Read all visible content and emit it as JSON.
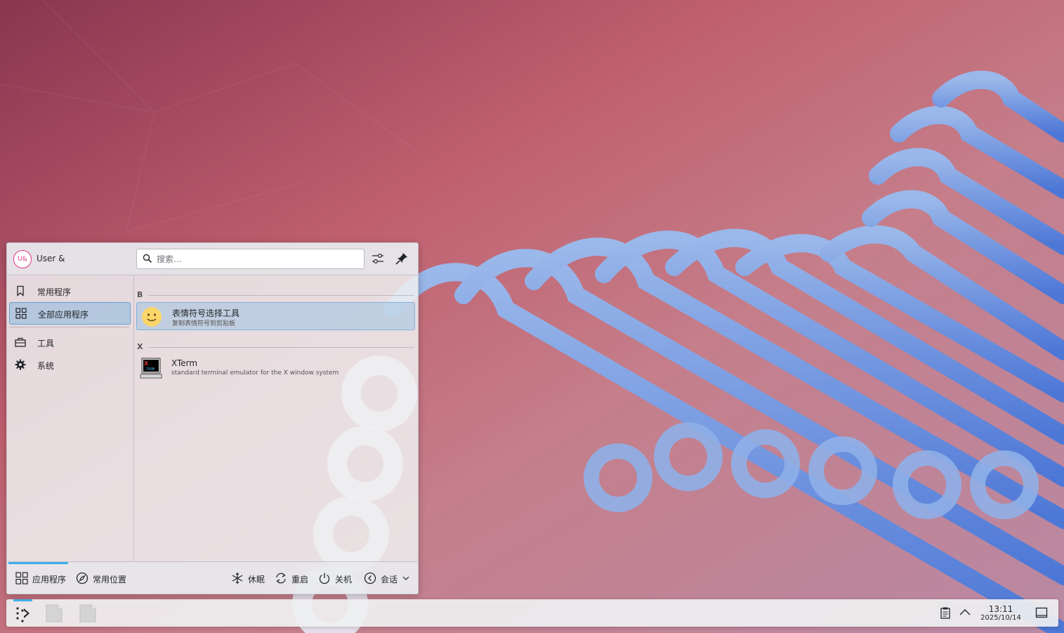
{
  "launcher": {
    "avatar_initials": "U&",
    "username": "User &",
    "search_placeholder": "搜索…",
    "sidebar": [
      {
        "label": "常用程序",
        "icon": "bookmark-icon",
        "active": false
      },
      {
        "label": "全部应用程序",
        "icon": "grid-icon",
        "active": true
      },
      {
        "label": "工具",
        "icon": "toolbox-icon",
        "active": false
      },
      {
        "label": "系统",
        "icon": "gear-icon",
        "active": false
      }
    ],
    "sections": [
      {
        "letter": "B",
        "apps": [
          {
            "name": "表情符号选择工具",
            "description": "复制表情符号到剪贴板",
            "icon": "emoji-icon",
            "highlighted": true
          }
        ]
      },
      {
        "letter": "X",
        "apps": [
          {
            "name": "XTerm",
            "description": "standard terminal emulator for the X window system",
            "icon": "xterm-icon",
            "highlighted": false
          }
        ]
      }
    ],
    "footer": {
      "tabs": [
        {
          "label": "应用程序",
          "icon": "grid-icon",
          "active": true
        },
        {
          "label": "常用位置",
          "icon": "compass-icon",
          "active": false
        }
      ],
      "actions": [
        {
          "label": "休眠",
          "icon": "snowflake-icon"
        },
        {
          "label": "重启",
          "icon": "restart-icon"
        },
        {
          "label": "关机",
          "icon": "power-icon"
        },
        {
          "label": "会话",
          "icon": "session-icon"
        }
      ]
    }
  },
  "taskbar": {
    "clock_time": "13:11",
    "clock_date": "2025/10/14"
  },
  "colors": {
    "accent": "#3daee9",
    "avatar_ring": "#e0348a",
    "selection": "#93bade"
  }
}
